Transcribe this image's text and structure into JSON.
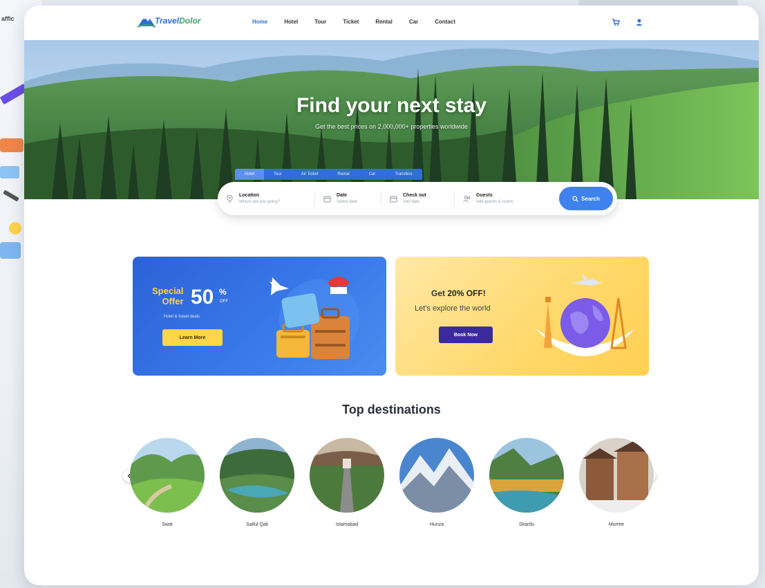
{
  "background": {
    "left_label": "affic"
  },
  "header": {
    "logo": {
      "primary": "Travel",
      "accent": "Dolor"
    },
    "nav": [
      {
        "label": "Home",
        "active": true
      },
      {
        "label": "Hotel",
        "active": false
      },
      {
        "label": "Tour",
        "active": false
      },
      {
        "label": "Ticket",
        "active": false
      },
      {
        "label": "Rental",
        "active": false
      },
      {
        "label": "Car",
        "active": false
      },
      {
        "label": "Contact",
        "active": false
      }
    ],
    "icons": [
      "cart-icon",
      "user-icon"
    ]
  },
  "hero": {
    "title": "Find your next stay",
    "subtitle": "Get the best prices on 2,000,000+ properties worldwide",
    "tabs": [
      "Hotel",
      "Tour",
      "Air Ticket",
      "Rental",
      "Car",
      "Transfers"
    ],
    "active_tab": 0
  },
  "search": {
    "fields": [
      {
        "label": "Location",
        "placeholder": "Where are you going?",
        "icon": "pin-icon"
      },
      {
        "label": "Date",
        "placeholder": "Select date",
        "icon": "calendar-icon"
      },
      {
        "label": "Check out",
        "placeholder": "Add date",
        "icon": "calendar-icon"
      },
      {
        "label": "Guests",
        "placeholder": "Add guests & rooms",
        "icon": "guests-icon"
      }
    ],
    "button_label": "Search"
  },
  "promos": {
    "blue": {
      "special_line1": "Special",
      "special_line2": "Offer",
      "percent": "50",
      "percent_sign": "%",
      "off": "OFF",
      "subtitle": "Hotel & travel deals",
      "button": "Learn More",
      "accent": "#ffd54a"
    },
    "yellow": {
      "title_prefix": "Get",
      "title_bold": "20% OFF!",
      "subtitle": "Let's explore the world",
      "button": "Book Now",
      "button_color": "#3b2a9c"
    }
  },
  "destinations": {
    "title": "Top destinations",
    "items": [
      {
        "name": "Swat"
      },
      {
        "name": "Saiful Qali"
      },
      {
        "name": "Islamabad"
      },
      {
        "name": "Hunza"
      },
      {
        "name": "Skardu"
      },
      {
        "name": "Murree"
      }
    ]
  },
  "colors": {
    "primary": "#2f6fd6",
    "search_button": "#3f82ee"
  }
}
